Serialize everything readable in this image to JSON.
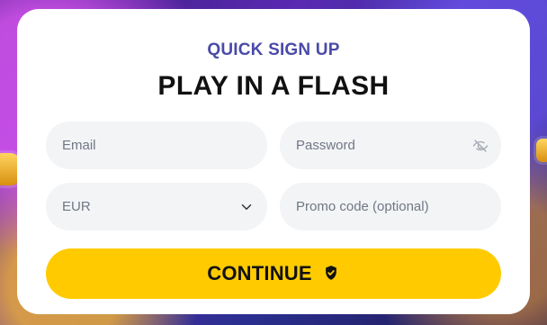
{
  "header": {
    "subtitle": "QUICK SIGN UP",
    "title": "PLAY IN A FLASH"
  },
  "form": {
    "email_placeholder": "Email",
    "password_placeholder": "Password",
    "currency_value": "EUR",
    "promo_placeholder": "Promo code (optional)",
    "continue_label": "CONTINUE"
  },
  "icons": {
    "password_toggle": "eye-off-icon",
    "currency_dropdown": "chevron-down-icon",
    "continue_badge": "shield-check-icon"
  },
  "colors": {
    "accent_text": "#4a4aa8",
    "primary_button": "#ffcb00",
    "card_background": "#ffffff",
    "input_background": "#f3f4f6",
    "title_text": "#111111"
  }
}
